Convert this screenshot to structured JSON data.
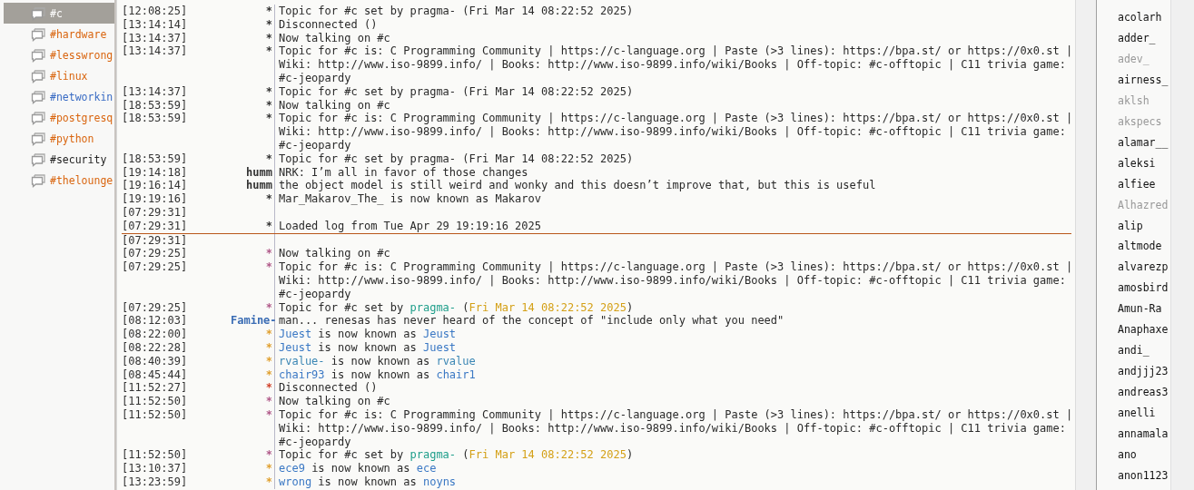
{
  "channels": [
    {
      "name": "#c",
      "selected": true,
      "color": "#ffffff"
    },
    {
      "name": "#hardware",
      "selected": false,
      "color": "#d9650f"
    },
    {
      "name": "#lesswrong",
      "selected": false,
      "color": "#d9650f"
    },
    {
      "name": "#linux",
      "selected": false,
      "color": "#d9650f"
    },
    {
      "name": "#networkin",
      "selected": false,
      "color": "#3a6cc4"
    },
    {
      "name": "#postgresq",
      "selected": false,
      "color": "#d9650f"
    },
    {
      "name": "#python",
      "selected": false,
      "color": "#d9650f"
    },
    {
      "name": "#security",
      "selected": false,
      "color": "#222222"
    },
    {
      "name": "#thelounge",
      "selected": false,
      "color": "#d9650f"
    }
  ],
  "messages": [
    {
      "kind": "message",
      "time": "[12:08:25]",
      "nick": "*",
      "parts": [
        {
          "text": "Topic for #c set by pragma- (Fri Mar 14 08:22:52 2025)"
        }
      ]
    },
    {
      "kind": "message",
      "time": "[13:14:14]",
      "nick": "*",
      "parts": [
        {
          "text": "Disconnected ()"
        }
      ]
    },
    {
      "kind": "message",
      "time": "[13:14:37]",
      "nick": "*",
      "parts": [
        {
          "text": "Now talking on #c"
        }
      ]
    },
    {
      "kind": "message",
      "time": "[13:14:37]",
      "nick": "*",
      "parts": [
        {
          "text": "Topic for #c is: C Programming Community | https://c-language.org | Paste (>3 lines): https://bpa.st/ or https://0x0.st | Wiki: http://www.iso-9899.info/ | Books: http://www.iso-9899.info/wiki/Books | Off-topic: #c-offtopic | C11 trivia game: #c-jeopardy"
        }
      ]
    },
    {
      "kind": "message",
      "time": "[13:14:37]",
      "nick": "*",
      "parts": [
        {
          "text": "Topic for #c set by pragma- (Fri Mar 14 08:22:52 2025)"
        }
      ]
    },
    {
      "kind": "message",
      "time": "[18:53:59]",
      "nick": "*",
      "parts": [
        {
          "text": "Now talking on #c"
        }
      ]
    },
    {
      "kind": "message",
      "time": "[18:53:59]",
      "nick": "*",
      "parts": [
        {
          "text": "Topic for #c is: C Programming Community | https://c-language.org | Paste (>3 lines): https://bpa.st/ or https://0x0.st | Wiki: http://www.iso-9899.info/ | Books: http://www.iso-9899.info/wiki/Books | Off-topic: #c-offtopic | C11 trivia game: #c-jeopardy"
        }
      ]
    },
    {
      "kind": "message",
      "time": "[18:53:59]",
      "nick": "*",
      "parts": [
        {
          "text": "Topic for #c set by pragma- (Fri Mar 14 08:22:52 2025)"
        }
      ]
    },
    {
      "kind": "message",
      "time": "[19:14:18]",
      "nick": "humm",
      "parts": [
        {
          "text": "NRK: I’m all in favor of those changes"
        }
      ]
    },
    {
      "kind": "message",
      "time": "[19:16:14]",
      "nick": "humm",
      "parts": [
        {
          "text": "the object model is still weird and wonky and this doesn’t improve that, but this is useful"
        }
      ]
    },
    {
      "kind": "message",
      "time": "[19:19:16]",
      "nick": "*",
      "parts": [
        {
          "text": "Mar_Makarov_The_ is now known as Makarov"
        }
      ]
    },
    {
      "kind": "message",
      "time": "[07:29:31]"
    },
    {
      "kind": "message",
      "time": "[07:29:31]",
      "nick": "*",
      "parts": [
        {
          "text": "Loaded log from Tue Apr 29 19:19:16 2025"
        }
      ]
    },
    {
      "kind": "divider"
    },
    {
      "kind": "message",
      "time": "[07:29:31]"
    },
    {
      "kind": "message",
      "time": "[07:29:25]",
      "nick": "*",
      "color": "#b05a8a",
      "parts": [
        {
          "text": "Now talking on #c"
        }
      ]
    },
    {
      "kind": "message",
      "time": "[07:29:25]",
      "nick": "*",
      "color": "#b05a8a",
      "parts": [
        {
          "text": "Topic for #c is: C Programming Community | https://c-language.org | Paste (>3 lines): https://bpa.st/ or https://0x0.st | Wiki: http://www.iso-9899.info/ | Books: http://www.iso-9899.info/wiki/Books | Off-topic: #c-offtopic | C11 trivia game: #c-jeopardy"
        }
      ]
    },
    {
      "kind": "message",
      "time": "[07:29:25]",
      "nick": "*",
      "color": "#b05a8a",
      "parts": [
        {
          "text": "Topic for #c set by "
        },
        {
          "text": "pragma-",
          "color": "#1e9e8a"
        },
        {
          "text": " ("
        },
        {
          "text": "Fri Mar 14 08:22:52 2025",
          "color": "#d4a017"
        },
        {
          "text": ")"
        }
      ]
    },
    {
      "kind": "message",
      "time": "[08:12:03]",
      "nick": "Famine-",
      "color": "#3a6cb4",
      "parts": [
        {
          "text": "man... renesas has never heard of the concept of \"include only what you need\""
        }
      ]
    },
    {
      "kind": "message",
      "time": "[08:22:00]",
      "nick": "*",
      "color": "#e0a030",
      "parts": [
        {
          "text": "Juest",
          "color": "#3a78c4"
        },
        {
          "text": " is now known as "
        },
        {
          "text": "Jeust",
          "color": "#3a78c4"
        }
      ]
    },
    {
      "kind": "message",
      "time": "[08:22:28]",
      "nick": "*",
      "color": "#e0a030",
      "parts": [
        {
          "text": "Jeust",
          "color": "#3a78c4"
        },
        {
          "text": " is now known as "
        },
        {
          "text": "Juest",
          "color": "#3a78c4"
        }
      ]
    },
    {
      "kind": "message",
      "time": "[08:40:39]",
      "nick": "*",
      "color": "#e0a030",
      "parts": [
        {
          "text": "rvalue-",
          "color": "#3a86b4"
        },
        {
          "text": " is now known as "
        },
        {
          "text": "rvalue",
          "color": "#3a86b4"
        }
      ]
    },
    {
      "kind": "message",
      "time": "[08:45:44]",
      "nick": "*",
      "color": "#e0a030",
      "parts": [
        {
          "text": "chair93",
          "color": "#3a78c4"
        },
        {
          "text": " is now known as "
        },
        {
          "text": "chair1",
          "color": "#3a78c4"
        }
      ]
    },
    {
      "kind": "message",
      "time": "[11:52:27]",
      "nick": "*",
      "color": "#d0402a",
      "parts": [
        {
          "text": "Disconnected ()"
        }
      ]
    },
    {
      "kind": "message",
      "time": "[11:52:50]",
      "nick": "*",
      "color": "#b05a8a",
      "parts": [
        {
          "text": "Now talking on #c"
        }
      ]
    },
    {
      "kind": "message",
      "time": "[11:52:50]",
      "nick": "*",
      "color": "#b05a8a",
      "parts": [
        {
          "text": "Topic for #c is: C Programming Community | https://c-language.org | Paste (>3 lines): https://bpa.st/ or https://0x0.st | Wiki: http://www.iso-9899.info/ | Books: http://www.iso-9899.info/wiki/Books | Off-topic: #c-offtopic | C11 trivia game: #c-jeopardy"
        }
      ]
    },
    {
      "kind": "message",
      "time": "[11:52:50]",
      "nick": "*",
      "color": "#b05a8a",
      "parts": [
        {
          "text": "Topic for #c set by "
        },
        {
          "text": "pragma-",
          "color": "#1e9e8a"
        },
        {
          "text": " ("
        },
        {
          "text": "Fri Mar 14 08:22:52 2025",
          "color": "#d4a017"
        },
        {
          "text": ")"
        }
      ]
    },
    {
      "kind": "message",
      "time": "[13:10:37]",
      "nick": "*",
      "color": "#e0a030",
      "parts": [
        {
          "text": "ece9",
          "color": "#3a78c4"
        },
        {
          "text": " is now known as "
        },
        {
          "text": "ece",
          "color": "#3a78c4"
        }
      ]
    },
    {
      "kind": "message",
      "time": "[13:23:59]",
      "nick": "*",
      "color": "#e0a030",
      "parts": [
        {
          "text": "wrong",
          "color": "#3a78c4"
        },
        {
          "text": " is now known as "
        },
        {
          "text": "noyns",
          "color": "#3a78c4"
        }
      ]
    }
  ],
  "users": [
    {
      "name": "acolarh",
      "away": false
    },
    {
      "name": "adder_",
      "away": false
    },
    {
      "name": "adev_",
      "away": true
    },
    {
      "name": "airness_",
      "away": false
    },
    {
      "name": "aklsh",
      "away": true
    },
    {
      "name": "akspecs",
      "away": true
    },
    {
      "name": "alamar__",
      "away": false
    },
    {
      "name": "aleksi",
      "away": false
    },
    {
      "name": "alfiee",
      "away": false
    },
    {
      "name": "Alhazred",
      "away": true
    },
    {
      "name": "alip",
      "away": false
    },
    {
      "name": "altmode",
      "away": false
    },
    {
      "name": "alvarezp",
      "away": false
    },
    {
      "name": "amosbird",
      "away": false
    },
    {
      "name": "Amun-Ra",
      "away": false
    },
    {
      "name": "Anaphaxe",
      "away": false
    },
    {
      "name": "andi_",
      "away": false
    },
    {
      "name": "andjjj23",
      "away": false
    },
    {
      "name": "andreas3",
      "away": false
    },
    {
      "name": "anelli",
      "away": false
    },
    {
      "name": "annamala",
      "away": false
    },
    {
      "name": "ano",
      "away": false
    },
    {
      "name": "anon1123",
      "away": false
    }
  ]
}
